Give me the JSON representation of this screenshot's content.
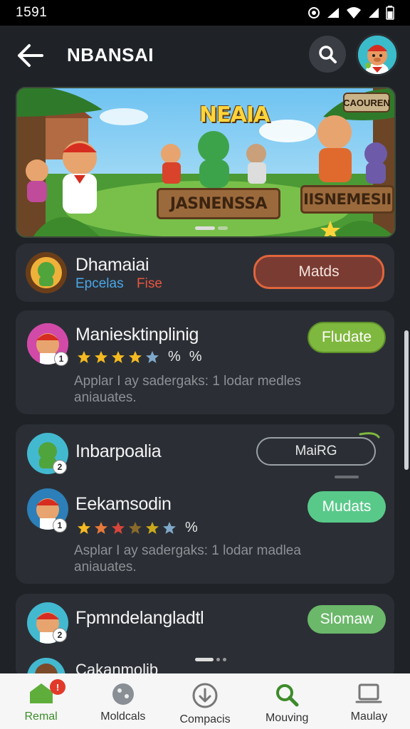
{
  "status_bar": {
    "time": "1591"
  },
  "header": {
    "title": "NBANSAI"
  },
  "banner": {
    "title": "NEAIA",
    "corner_tag": "CAOUREN",
    "sign_left": "JASNENSSA",
    "sign_right": "IISNEMESII"
  },
  "cards": [
    {
      "name": "Dhamaiai",
      "sub_blue": "Epcelas",
      "sub_red": "Fise",
      "button": "Matds"
    },
    {
      "name": "Maniesktinplinig",
      "rating": 4,
      "pct_1": "%",
      "pct_2": "%",
      "button": "Fludate",
      "desc_1": "Applar I ay sadergaks: 1 lodar medles",
      "desc_2": "aniauates."
    },
    {
      "name": "Inbarpoalia",
      "button": "MaiRG",
      "badge": "2"
    },
    {
      "name": "Eekamsodin",
      "rating": 4,
      "pct_1": "%",
      "button": "Mudats",
      "desc_1": "Asplar I ay sadergaks: 1 lodar madlea",
      "desc_2": "aniauates."
    },
    {
      "name": "Fpmndelangladtl",
      "button": "Slomaw",
      "badge": "2"
    },
    {
      "name": "Cakanmolib"
    }
  ],
  "card_badges": {
    "card2": "1",
    "card4": "1"
  },
  "bottom_nav": [
    {
      "label": "Remal",
      "icon": "home-icon",
      "badge": "!"
    },
    {
      "label": "Moldcals",
      "icon": "globe-icon"
    },
    {
      "label": "Compacis",
      "icon": "download-icon"
    },
    {
      "label": "Mouving",
      "icon": "search-icon"
    },
    {
      "label": "Maulay",
      "icon": "laptop-icon"
    }
  ],
  "colors": {
    "background": "#1f2328",
    "card": "#2b2f35",
    "accent_green": "#7fb83e",
    "accent_teal": "#59c98a",
    "accent_orange": "#e0653d",
    "nav_active": "#3d8b2a"
  }
}
